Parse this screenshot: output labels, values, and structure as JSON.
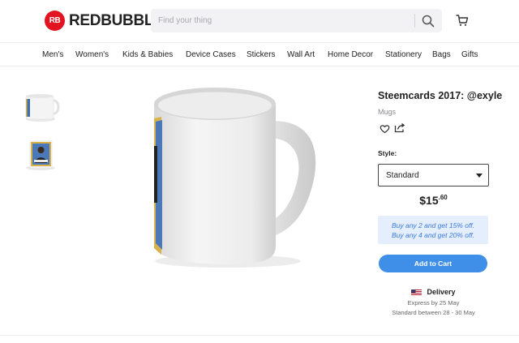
{
  "brand": {
    "logo_mark": "RB",
    "name": "REDBUBBLE",
    "color": "#e41321"
  },
  "search": {
    "placeholder": "Find your thing",
    "value": "",
    "icon": "search-icon"
  },
  "cart": {
    "icon": "shopping-cart-icon"
  },
  "nav": {
    "items": [
      "Men's",
      "Women's",
      "Kids & Babies",
      "Device Cases",
      "Stickers",
      "Wall Art",
      "Home Decor",
      "Stationery",
      "Bags",
      "Gifts"
    ]
  },
  "gallery": {
    "thumbnails": [
      "mug-front-view",
      "mug-design-view"
    ],
    "main_image": "white-ceramic-mug"
  },
  "product": {
    "title": "Steemcards 2017: @exyle",
    "category": "Mugs",
    "favorite_icon": "heart-icon",
    "share_icon": "share-icon",
    "style_label": "Style:",
    "style_selected": "Standard",
    "price_main": "$15",
    "price_cents": ".60",
    "promo_line1": "Buy any 2 and get 15% off.",
    "promo_line2": "Buy any 4 and get 20% off.",
    "add_to_cart": "Add to Cart",
    "delivery_title": "Delivery",
    "delivery_express": "Express by 25 May",
    "delivery_standard": "Standard between 28 - 30 May"
  },
  "colors": {
    "accent": "#3f8fe9",
    "promo_bg": "#e4eefc",
    "promo_text": "#3b7ae0"
  }
}
